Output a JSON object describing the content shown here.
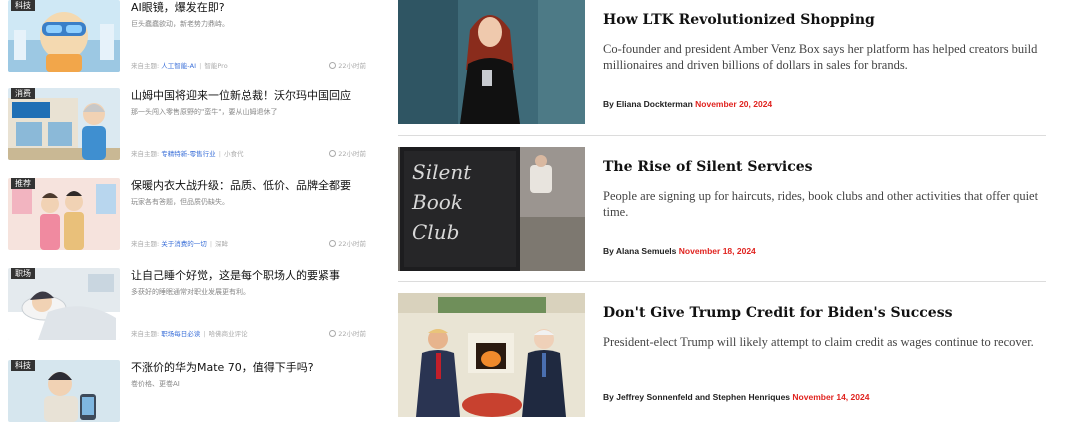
{
  "left_feed": {
    "items": [
      {
        "tag": "科技",
        "title": "AI眼镜，爆发在即?",
        "subtitle": "巨头蠢蠢欲动，新老势力鼎峙。",
        "meta_prefix": "来自主题:",
        "meta_link": "人工智能-AI",
        "meta_extra": "智能Pro",
        "time": "22小时前"
      },
      {
        "tag": "消费",
        "title": "山姆中国将迎来一位新总裁！沃尔玛中国回应",
        "subtitle": "那一头闯入零售原野的\"蛮牛\"，要从山姆退休了",
        "meta_prefix": "来自主题:",
        "meta_link": "专精特新-零售行业",
        "meta_extra": "小食代",
        "time": "22小时前"
      },
      {
        "tag": "推荐",
        "title": "保暖内衣大战升级：品质、低价、品牌全都要",
        "subtitle": "玩家各有答题，但品质仍缺失。",
        "meta_prefix": "来自主题:",
        "meta_link": "关于消费的一切",
        "meta_extra": "深眸",
        "time": "22小时前"
      },
      {
        "tag": "职场",
        "title": "让自己睡个好觉，这是每个职场人的要紧事",
        "subtitle": "多获好的睡眠通常对职业发展更有利。",
        "meta_prefix": "来自主题:",
        "meta_link": "职场每日必读",
        "meta_extra": "哈佛商业评论",
        "time": "22小时前"
      },
      {
        "tag": "科技",
        "title": "不涨价的华为Mate 70，值得下手吗?",
        "subtitle": "卷价格、更卷AI",
        "meta_prefix": "",
        "meta_link": "",
        "meta_extra": "",
        "time": ""
      }
    ]
  },
  "right_feed": {
    "articles": [
      {
        "title": "How LTK Revolutionized Shopping",
        "description": "Co-founder and president Amber Venz Box says her platform has helped creators build millionaires and driven billions of dollars in sales for brands.",
        "byline_prefix": "By Eliana Dockterman",
        "date": "November 20, 2024"
      },
      {
        "title": "The Rise of Silent Services",
        "description": "People are signing up for haircuts, rides, book clubs and other activities that offer quiet time.",
        "byline_prefix": "By Alana Semuels",
        "date": "November 18, 2024",
        "image_sign_text": "Silent Book Club"
      },
      {
        "title": "Don't Give Trump Credit for Biden's Success",
        "description": "President-elect Trump will likely attempt to claim credit as wages continue to recover.",
        "byline_prefix": "By Jeffrey Sonnenfeld and Stephen Henriques",
        "date": "November 14, 2024"
      }
    ]
  },
  "colors": {
    "link_blue": "#3a6fd8",
    "date_red": "#e0231f",
    "tag_bg": "#333333",
    "divider": "#dcdcdc"
  }
}
